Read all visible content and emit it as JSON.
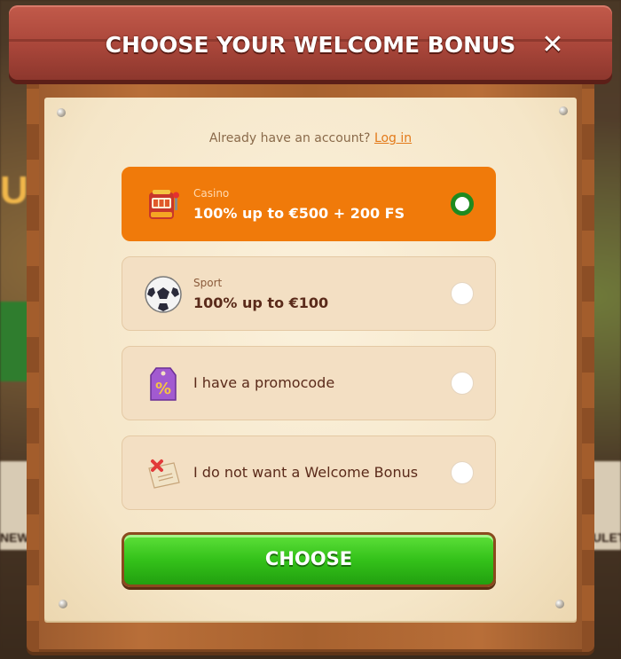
{
  "background": {
    "left_label": "NEW",
    "right_label": "ULET",
    "big_text": "UP"
  },
  "modal": {
    "title": "CHOOSE YOUR WELCOME BONUS",
    "close_icon": "close-icon",
    "login_prompt": "Already have an account?",
    "login_link": "Log in",
    "options": [
      {
        "category": "Casino",
        "title": "100% up to €500 + 200 FS",
        "icon": "slot-machine-icon",
        "selected": true
      },
      {
        "category": "Sport",
        "title": "100% up to €100",
        "icon": "soccer-ball-icon",
        "selected": false
      },
      {
        "category": "",
        "title": "I have a promocode",
        "icon": "percent-tag-icon",
        "selected": false
      },
      {
        "category": "",
        "title": "I do not want a Welcome Bonus",
        "icon": "no-bonus-scroll-icon",
        "selected": false
      }
    ],
    "choose_label": "CHOOSE"
  },
  "colors": {
    "selected_option": "#f07a0a",
    "choose_button": "#34c21a",
    "header_plank": "#a9463a",
    "radio_selected": "#1f8a1f"
  }
}
